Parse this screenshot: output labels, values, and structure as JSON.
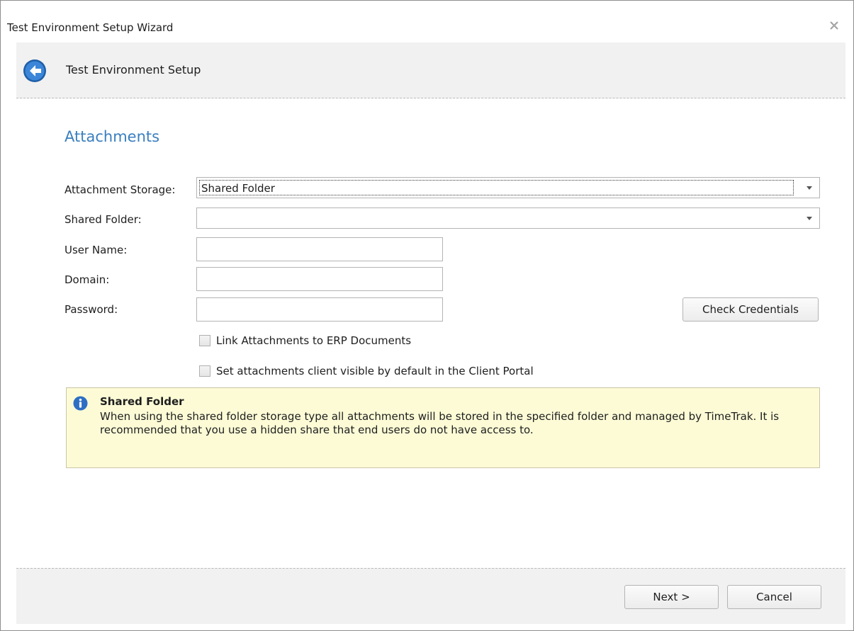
{
  "window": {
    "title": "Test Environment Setup Wizard"
  },
  "header": {
    "title": "Test Environment Setup"
  },
  "section": {
    "title": "Attachments"
  },
  "form": {
    "attachment_storage_label": "Attachment Storage:",
    "attachment_storage_value": "Shared Folder",
    "shared_folder_label": "Shared Folder:",
    "shared_folder_value": "",
    "user_name_label": "User Name:",
    "user_name_value": "",
    "domain_label": "Domain:",
    "domain_value": "",
    "password_label": "Password:",
    "password_value": "",
    "check_credentials_label": "Check Credentials",
    "link_attachments_label": "Link Attachments to ERP Documents",
    "link_attachments_checked": false,
    "client_visible_label": "Set attachments client visible by default in the Client Portal",
    "client_visible_checked": false
  },
  "info": {
    "title": "Shared Folder",
    "text": "When using the shared folder storage type all attachments will be stored in the specified folder and managed by TimeTrak. It is recommended that you use a hidden share that end users do not have access to."
  },
  "footer": {
    "next_label": "Next >",
    "cancel_label": "Cancel"
  },
  "colors": {
    "accent": "#3a7fbf",
    "info_background": "#fcfbd6",
    "panel_background": "#f1f1f1"
  },
  "icons": {
    "close": "close-icon",
    "back": "back-arrow-icon",
    "info": "info-icon",
    "dropdown": "chevron-down-icon"
  }
}
